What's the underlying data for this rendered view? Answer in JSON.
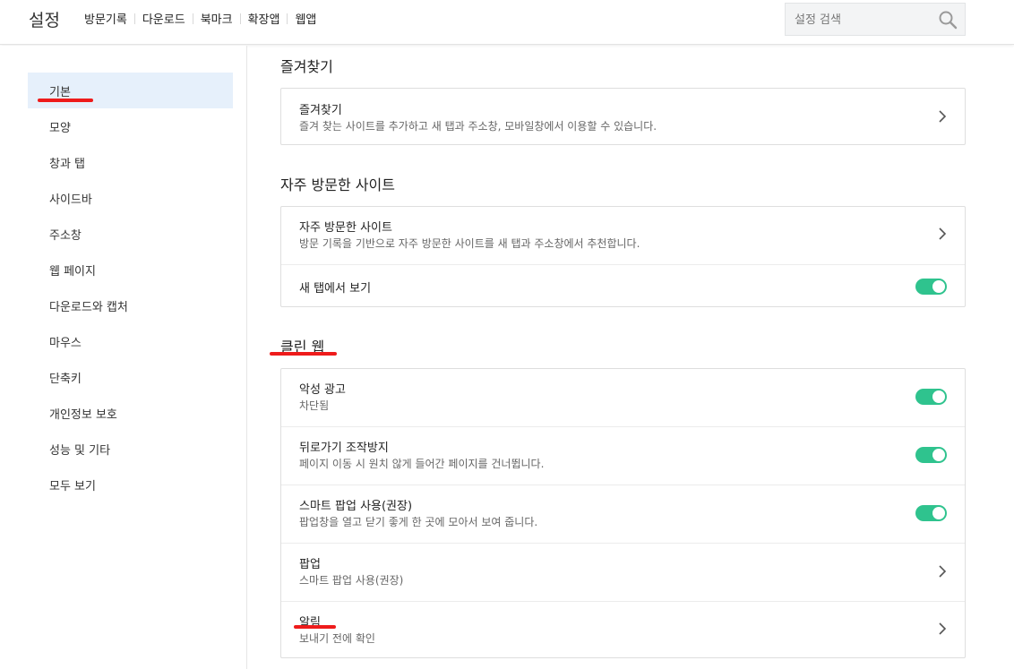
{
  "header": {
    "title": "설정",
    "nav": [
      "방문기록",
      "다운로드",
      "북마크",
      "확장앱",
      "웹앱"
    ],
    "search_placeholder": "설정 검색"
  },
  "sidebar": {
    "items": [
      "기본",
      "모양",
      "창과 탭",
      "사이드바",
      "주소창",
      "웹 페이지",
      "다운로드와 캡처",
      "마우스",
      "단축키",
      "개인정보 보호",
      "성능 및 기타",
      "모두 보기"
    ],
    "active_index": 0
  },
  "sections": {
    "favorites": {
      "title": "즐겨찾기",
      "row": {
        "title": "즐겨찾기",
        "desc": "즐겨 찾는 사이트를 추가하고 새 탭과 주소창, 모바일창에서 이용할 수 있습니다."
      }
    },
    "frequent": {
      "title": "자주 방문한 사이트",
      "row": {
        "title": "자주 방문한 사이트",
        "desc": "방문 기록을 기반으로 자주 방문한 사이트를 새 탭과 주소창에서 추천합니다."
      },
      "toggle_row": {
        "title": "새 탭에서 보기",
        "on": true
      }
    },
    "clean_web": {
      "title": "클린 웹",
      "rows": [
        {
          "title": "악성 광고",
          "desc": "차단됨",
          "control": "toggle",
          "on": true
        },
        {
          "title": "뒤로가기 조작방지",
          "desc": "페이지 이동 시 원치 않게 들어간 페이지를 건너뜁니다.",
          "control": "toggle",
          "on": true
        },
        {
          "title": "스마트 팝업 사용(권장)",
          "desc": "팝업창을 열고 닫기 좋게 한 곳에 모아서 보여 줍니다.",
          "control": "toggle",
          "on": true
        },
        {
          "title": "팝업",
          "desc": "스마트 팝업 사용(권장)",
          "control": "chevron"
        },
        {
          "title": "알림",
          "desc": "보내기 전에 확인",
          "control": "chevron"
        }
      ]
    }
  },
  "colors": {
    "toggle_on": "#2fc38e",
    "active_bg": "#e6f0fb",
    "annotation": "#ee1b1b"
  }
}
